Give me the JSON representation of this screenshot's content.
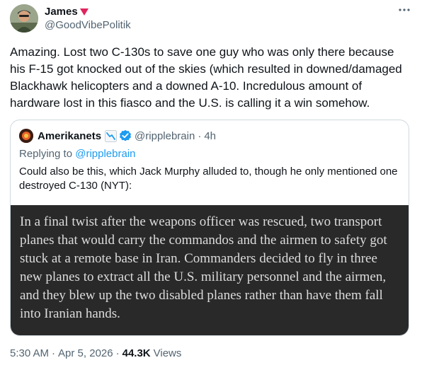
{
  "author": {
    "name": "James",
    "handle": "@GoodVibePolitik",
    "flag_color": "#e0245e"
  },
  "tweet": {
    "text": "Amazing. Lost two C-130s to save one guy who was only there because his F-15 got knocked out of the skies (which resulted in downed/damaged Blackhawk helicopters and a downed A-10. Incredulous amount of hardware lost in this fiasco and the U.S. is calling it a win somehow."
  },
  "quote": {
    "name": "Amerikanets",
    "handle": "@ripplebrain",
    "time": "4h",
    "separator": "·",
    "reply_prefix": "Replying to",
    "reply_handle": "@ripplebrain",
    "body": "Could also be this, which Jack Murphy alluded to, though he only mentioned one destroyed C-130 (NYT):",
    "image_text": "In a final twist after the weapons officer was rescued, two transport planes that would carry the commandos and the airmen to safety got stuck at a remote base in Iran. Commanders decided to fly in three new planes to extract all the U.S. military personnel and the airmen, and they blew up the two disabled planes rather than have them fall into Iranian hands."
  },
  "meta": {
    "time": "5:30 AM",
    "dot": "·",
    "date": "Apr 5, 2026",
    "views_count": "44.3K",
    "views_label": "Views"
  },
  "colors": {
    "accent": "#1d9bf0",
    "text": "#0f1419",
    "secondary": "#536471",
    "border": "#cfd9de",
    "image_bg": "#292929"
  }
}
